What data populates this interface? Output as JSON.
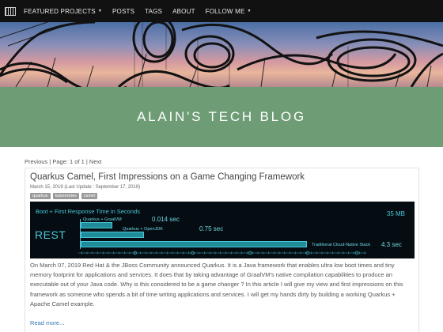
{
  "nav": {
    "items": [
      {
        "label": "FEATURED PROJECTS",
        "dropdown": true
      },
      {
        "label": "POSTS",
        "dropdown": false
      },
      {
        "label": "TAGS",
        "dropdown": false
      },
      {
        "label": "ABOUT",
        "dropdown": false
      },
      {
        "label": "FOLLOW ME",
        "dropdown": true
      }
    ]
  },
  "site": {
    "title": "ALAIN'S TECH BLOG"
  },
  "pagination": {
    "previous": "Previous",
    "page_text": "Page: 1 of 1",
    "next": "Next"
  },
  "post": {
    "title": "Quarkus Camel, First Impressions on a Game Changing Framework",
    "date": "March 15, 2019 (Last Update : September 17, 2019)",
    "tags": [
      "quarkus",
      "kubernetes",
      "camel"
    ],
    "banner": {
      "title": "Boot + First Response Time in Seconds",
      "memory_label": "35 MB",
      "row_label": "REST",
      "bars": [
        {
          "name": "Quarkus + GraalVM",
          "value": "0.014 sec",
          "fraction": 0.14
        },
        {
          "name": "Quarkus + OpenJDK",
          "value": "0.75 sec",
          "fraction": 0.28
        },
        {
          "name": "Traditional Cloud-Native Stack",
          "value": "4.3 sec",
          "fraction": 1.0
        }
      ]
    },
    "excerpt": "On March 07, 2019 Red Hat & the JBoss Community announced Quarkus. It is a Java framework that enables ultra low boot times and tiny memory footprint for applications and services. It does that by taking advantage of GraalVM's native compilation capabilities to produce an executable out of your Java code. Why is this considered to be a game changer ? In this article I will give my view and first impressions on this framework as someone who spends a bit of time writing applications and services. I will get my hands dirty by building a working Quarkus + Apache Camel example.",
    "read_more": "Read more..."
  },
  "colors": {
    "navbar": "#111111",
    "title_band": "#6e9c75",
    "banner_accent": "#49c5d6",
    "link": "#337ab7"
  },
  "icons": [
    "menu-brand-icon",
    "caret-down-icon"
  ]
}
